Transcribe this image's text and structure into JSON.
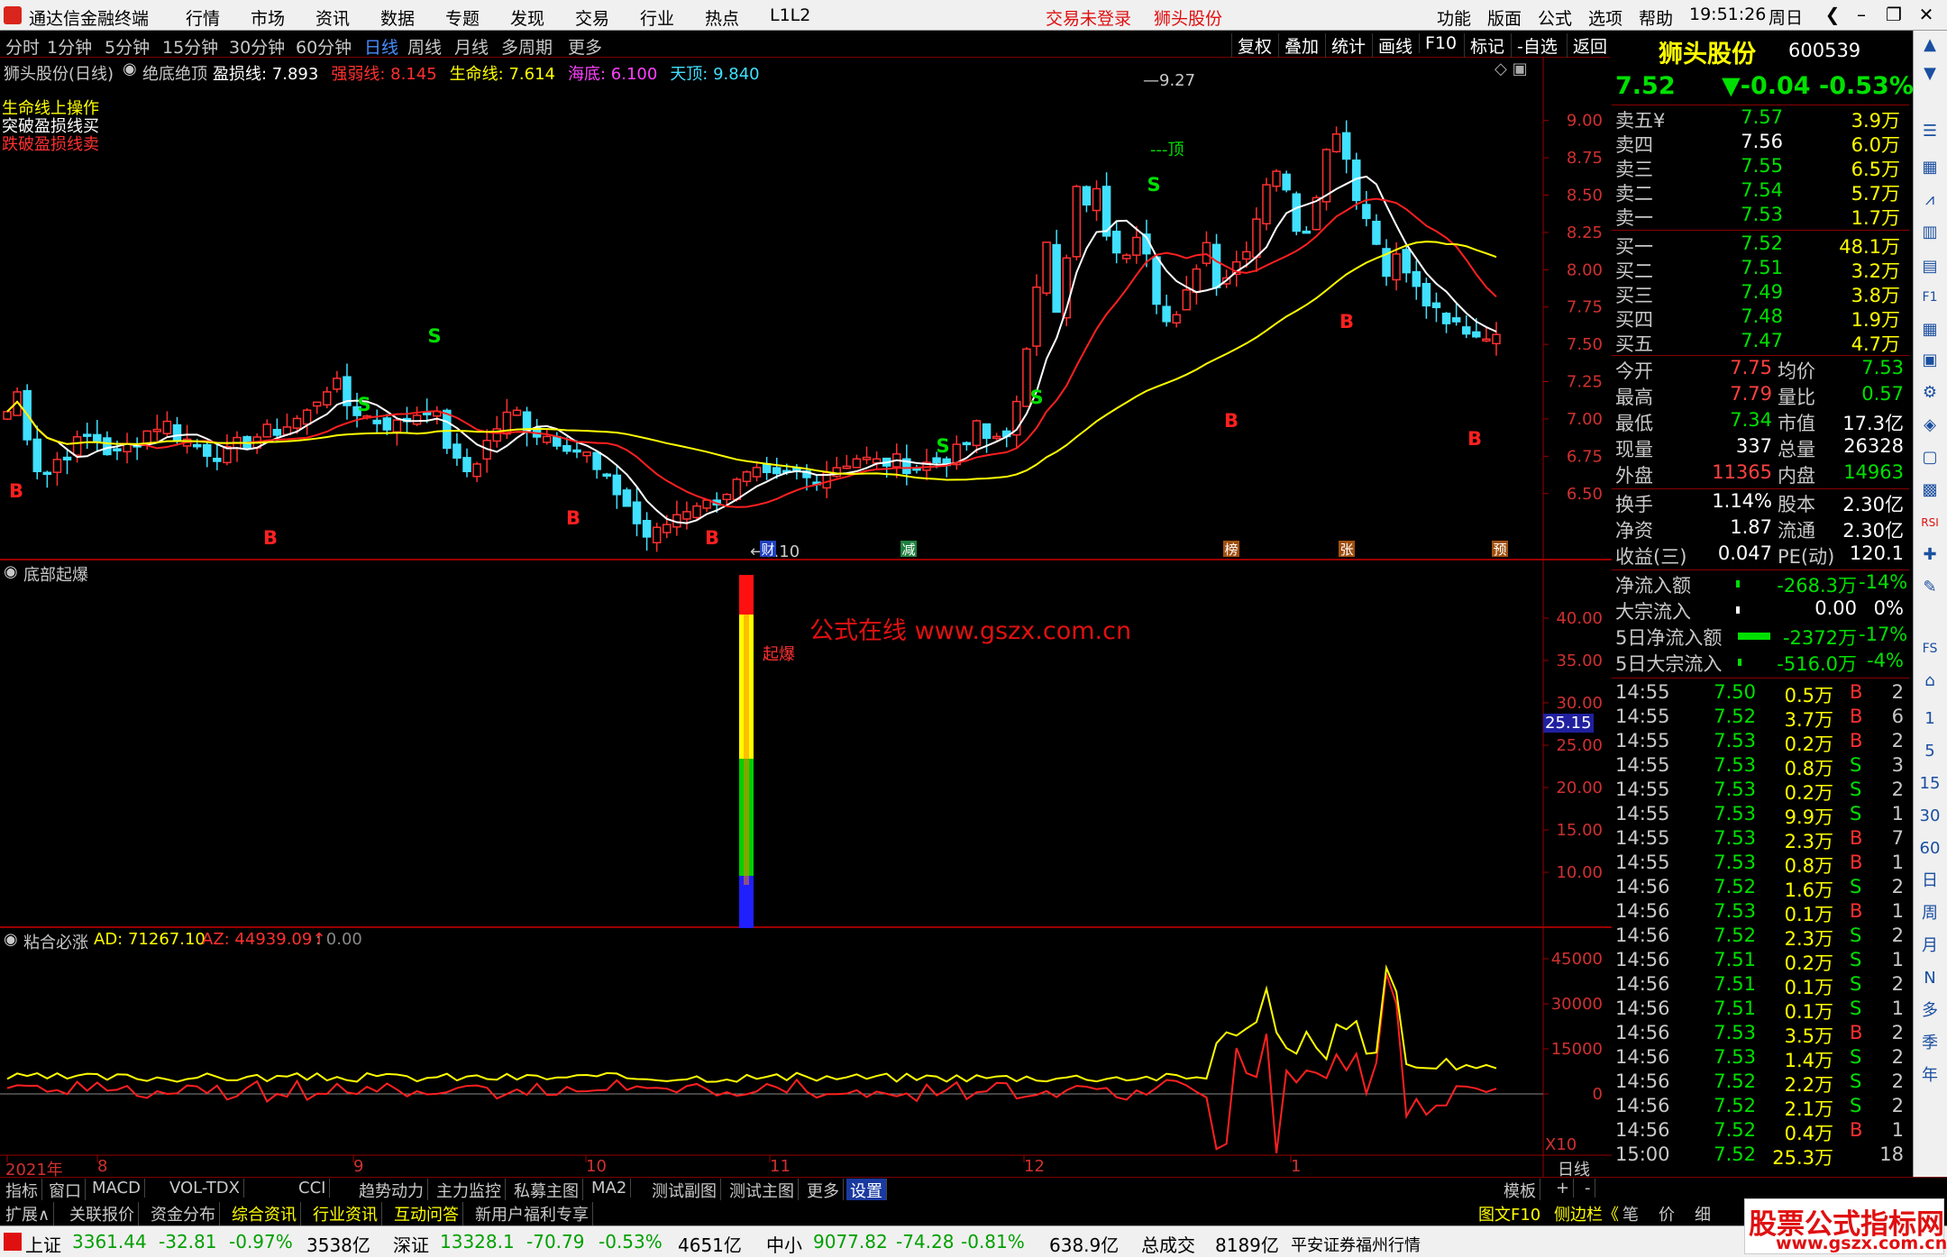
{
  "app": {
    "title": "通达信金融终端"
  },
  "menu": [
    "行情",
    "市场",
    "资讯",
    "数据",
    "专题",
    "发现",
    "交易",
    "行业",
    "热点",
    "L1L2"
  ],
  "menu_status": {
    "login": "交易未登录",
    "stock": "狮头股份"
  },
  "menu_right": [
    "功能",
    "版面",
    "公式",
    "选项",
    "帮助"
  ],
  "clock": "19:51:26",
  "weekday": "周日",
  "periods": [
    "分时",
    "1分钟",
    "5分钟",
    "15分钟",
    "30分钟",
    "60分钟",
    "日线",
    "周线",
    "月线",
    "多周期",
    "更多"
  ],
  "toolbar_right": [
    "复权",
    "叠加",
    "统计",
    "画线",
    "F10",
    "标记",
    "-自选",
    "返回"
  ],
  "main_chart": {
    "stock_label": "狮头股份(日线)",
    "indicator_name": "绝底绝顶",
    "fields": [
      {
        "label": "盈损线:",
        "value": "7.893",
        "color": "#ffffff"
      },
      {
        "label": "强弱线:",
        "value": "8.145",
        "color": "#ff3030"
      },
      {
        "label": "生命线:",
        "value": "7.614",
        "color": "#ffff00"
      },
      {
        "label": "海底:",
        "value": "6.100",
        "color": "#ff40ff"
      },
      {
        "label": "天顶:",
        "value": "9.840",
        "color": "#40e0ff"
      }
    ],
    "legend": [
      "生命线上操作",
      "突破盈损线买",
      "跌破盈损线卖"
    ],
    "high_label": "9.27",
    "low_label": "6.10",
    "top_label": "---顶",
    "y_ticks": [
      "9.00",
      "8.75",
      "8.50",
      "8.25",
      "8.00",
      "7.75",
      "7.50",
      "7.25",
      "7.00",
      "6.75",
      "6.50"
    ],
    "event_tags": [
      "财",
      "减",
      "榜",
      "张",
      "预"
    ]
  },
  "chart_data": [
    {
      "type": "candlestick",
      "title": "狮头股份(日线)",
      "ylim": [
        6.1,
        9.3
      ],
      "y_ticks": [
        6.5,
        6.75,
        7.0,
        7.25,
        7.5,
        7.75,
        8.0,
        8.25,
        8.5,
        8.75,
        9.0
      ],
      "x_labels": [
        "2021年",
        "8",
        "9",
        "10",
        "11",
        "12",
        "1"
      ],
      "series": [
        {
          "name": "盈损线",
          "value": 7.893,
          "color": "#ffffff"
        },
        {
          "name": "强弱线",
          "value": 8.145,
          "color": "#ff3030"
        },
        {
          "name": "生命线",
          "value": 7.614,
          "color": "#ffff00"
        }
      ],
      "annotations": {
        "high": 9.27,
        "low": 6.1
      }
    },
    {
      "type": "bar",
      "title": "底部起爆",
      "y_ticks": [
        10,
        15,
        20,
        25,
        30,
        35,
        40
      ],
      "current": 25.15
    },
    {
      "type": "line",
      "title": "粘合必涨",
      "series": [
        {
          "name": "AD",
          "value": 71267.1,
          "color": "#ffff00"
        },
        {
          "name": "AZ",
          "value": 44939.09,
          "color": "#ff3030"
        }
      ],
      "y_ticks": [
        0,
        15000,
        30000,
        45000
      ]
    }
  ],
  "sub1": {
    "name": "底部起爆",
    "watermark": "公式在线 www.gszx.com.cn",
    "bar_label": "起爆",
    "current": "25.15",
    "y_ticks": [
      "40.00",
      "35.00",
      "30.00",
      "25.00",
      "20.00",
      "15.00",
      "10.00"
    ]
  },
  "sub2": {
    "name": "粘合必涨",
    "ad_label": "AD: 71267.10",
    "az_label": "AZ: 44939.09↑",
    "extra": ": 0.00",
    "y_ticks": [
      "45000",
      "30000",
      "15000",
      "0"
    ],
    "scale": "X10"
  },
  "x_axis": {
    "labels": [
      "2021年",
      "8",
      "9",
      "10",
      "11",
      "12",
      "1"
    ],
    "right_label": "日线"
  },
  "quote": {
    "name": "狮头股份",
    "code": "600539",
    "price": "7.52",
    "change": "▼-0.04",
    "pct": "-0.53%",
    "asks": [
      {
        "label": "卖五¥",
        "price": "7.57",
        "vol": "3.9万"
      },
      {
        "label": "卖四",
        "price": "7.56",
        "vol": "6.0万"
      },
      {
        "label": "卖三",
        "price": "7.55",
        "vol": "6.5万"
      },
      {
        "label": "卖二",
        "price": "7.54",
        "vol": "5.7万"
      },
      {
        "label": "卖一",
        "price": "7.53",
        "vol": "1.7万"
      }
    ],
    "bids": [
      {
        "label": "买一",
        "price": "7.52",
        "vol": "48.1万"
      },
      {
        "label": "买二",
        "price": "7.51",
        "vol": "3.2万"
      },
      {
        "label": "买三",
        "price": "7.49",
        "vol": "3.8万"
      },
      {
        "label": "买四",
        "price": "7.48",
        "vol": "1.9万"
      },
      {
        "label": "买五",
        "price": "7.47",
        "vol": "4.7万"
      }
    ],
    "stats": [
      {
        "l1": "今开",
        "v1": "7.75",
        "c1": "#ff4040",
        "l2": "均价",
        "v2": "7.53",
        "c2": "#00e000"
      },
      {
        "l1": "最高",
        "v1": "7.79",
        "c1": "#ff4040",
        "l2": "量比",
        "v2": "0.57",
        "c2": "#00e000"
      },
      {
        "l1": "最低",
        "v1": "7.34",
        "c1": "#00e000",
        "l2": "市值",
        "v2": "17.3亿",
        "c2": "#ffffff"
      },
      {
        "l1": "现量",
        "v1": "337",
        "c1": "#ffffff",
        "l2": "总量",
        "v2": "26328",
        "c2": "#ffffff"
      },
      {
        "l1": "外盘",
        "v1": "11365",
        "c1": "#ff4040",
        "l2": "内盘",
        "v2": "14963",
        "c2": "#00e000"
      }
    ],
    "stats2": [
      {
        "l1": "换手",
        "v1": "1.14%",
        "l2": "股本",
        "v2": "2.30亿"
      },
      {
        "l1": "净资",
        "v1": "1.87",
        "l2": "流通",
        "v2": "2.30亿"
      },
      {
        "l1": "收益(三)",
        "v1": "0.047",
        "l2": "PE(动)",
        "v2": "120.1"
      }
    ],
    "flows": [
      {
        "label": "净流入额",
        "value": "-268.3万",
        "pct": "-14%",
        "color": "#00e000"
      },
      {
        "label": "大宗流入",
        "value": "0.00",
        "pct": "0%",
        "color": "#ffffff"
      },
      {
        "label": "5日净流入额",
        "value": "-2372万",
        "pct": "-17%",
        "color": "#00e000"
      },
      {
        "label": "5日大宗流入",
        "value": "-516.0万",
        "pct": "-4%",
        "color": "#00e000"
      }
    ]
  },
  "ticks": [
    {
      "t": "14:55",
      "p": "7.50",
      "v": "0.5万",
      "d": "B",
      "n": "2"
    },
    {
      "t": "14:55",
      "p": "7.52",
      "v": "3.7万",
      "d": "B",
      "n": "6"
    },
    {
      "t": "14:55",
      "p": "7.53",
      "v": "0.2万",
      "d": "B",
      "n": "2"
    },
    {
      "t": "14:55",
      "p": "7.53",
      "v": "0.8万",
      "d": "S",
      "n": "3"
    },
    {
      "t": "14:55",
      "p": "7.53",
      "v": "0.2万",
      "d": "S",
      "n": "2"
    },
    {
      "t": "14:55",
      "p": "7.53",
      "v": "9.9万",
      "d": "S",
      "n": "1"
    },
    {
      "t": "14:55",
      "p": "7.53",
      "v": "2.3万",
      "d": "B",
      "n": "7"
    },
    {
      "t": "14:55",
      "p": "7.53",
      "v": "0.8万",
      "d": "B",
      "n": "1"
    },
    {
      "t": "14:56",
      "p": "7.52",
      "v": "1.6万",
      "d": "S",
      "n": "2"
    },
    {
      "t": "14:56",
      "p": "7.53",
      "v": "0.1万",
      "d": "B",
      "n": "1"
    },
    {
      "t": "14:56",
      "p": "7.52",
      "v": "2.3万",
      "d": "S",
      "n": "2"
    },
    {
      "t": "14:56",
      "p": "7.51",
      "v": "0.2万",
      "d": "S",
      "n": "1"
    },
    {
      "t": "14:56",
      "p": "7.51",
      "v": "0.1万",
      "d": "S",
      "n": "2"
    },
    {
      "t": "14:56",
      "p": "7.51",
      "v": "0.1万",
      "d": "S",
      "n": "1"
    },
    {
      "t": "14:56",
      "p": "7.53",
      "v": "3.5万",
      "d": "B",
      "n": "2"
    },
    {
      "t": "14:56",
      "p": "7.53",
      "v": "1.4万",
      "d": "S",
      "n": "2"
    },
    {
      "t": "14:56",
      "p": "7.52",
      "v": "2.2万",
      "d": "S",
      "n": "2"
    },
    {
      "t": "14:56",
      "p": "7.52",
      "v": "2.1万",
      "d": "S",
      "n": "2"
    },
    {
      "t": "14:56",
      "p": "7.52",
      "v": "0.4万",
      "d": "B",
      "n": "1"
    },
    {
      "t": "15:00",
      "p": "7.52",
      "v": "25.3万",
      "d": "",
      "n": "18"
    }
  ],
  "bottom_tabs": [
    "指标",
    "窗口",
    "MACD",
    "VOL-TDX",
    "CCI",
    "趋势动力",
    "主力监控",
    "私募主图",
    "MA2",
    "测试副图",
    "测试主图",
    "更多",
    "设置"
  ],
  "bottom_right": [
    "模板",
    "+",
    "-"
  ],
  "news_tabs": [
    "扩展∧",
    "关联报价",
    "资金分布",
    "综合资讯",
    "行业资讯",
    "互动问答",
    "新用户福利专享"
  ],
  "news_right": [
    "图文F10",
    "侧边栏《",
    "笔",
    "价",
    "细"
  ],
  "status": {
    "sh": {
      "name": "上证",
      "val": "3361.44",
      "chg": "-32.81",
      "pct": "-0.97%",
      "amt": "3538亿"
    },
    "sz": {
      "name": "深证",
      "val": "13328.1",
      "chg": "-70.79",
      "pct": "-0.53%",
      "amt": "4651亿"
    },
    "zx": {
      "name": "中小",
      "val": "9077.82",
      "chg": "-74.28",
      "pct": "-0.81%",
      "amt": "638.9亿"
    },
    "total": {
      "name": "总成交",
      "amt": "8189亿"
    },
    "broker": "平安证券福州行情"
  },
  "brand": {
    "name": "股票公式指标网",
    "url": "www.gszx.com.cn"
  },
  "sidebar_icons": [
    "F1",
    "RSI",
    "FS",
    "1",
    "5",
    "15",
    "30",
    "60",
    "日",
    "周",
    "月",
    "N",
    "多",
    "季",
    "年"
  ]
}
